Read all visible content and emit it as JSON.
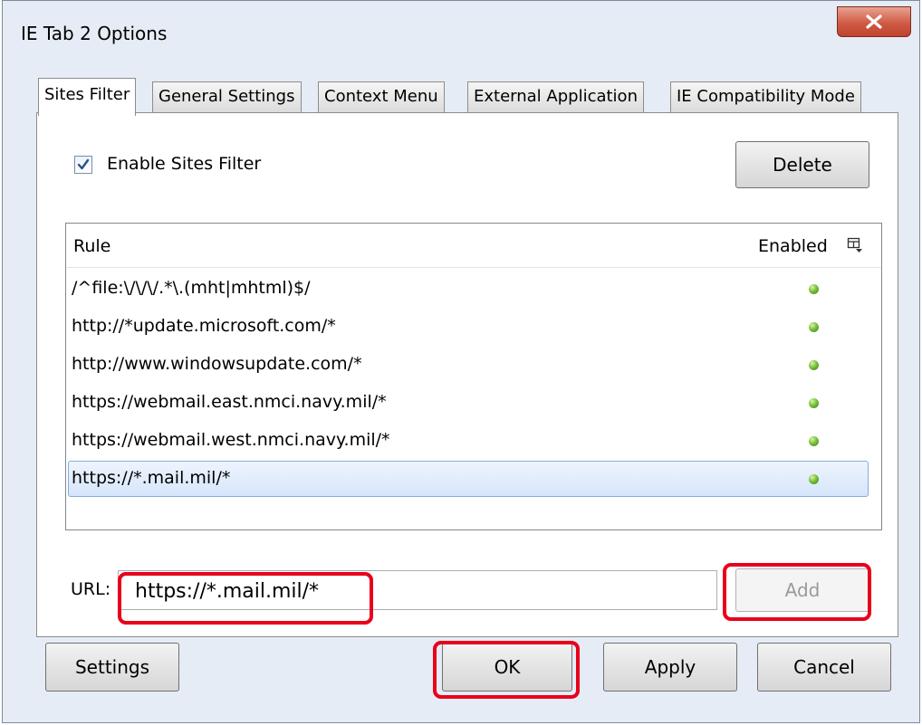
{
  "window": {
    "title": "IE Tab 2 Options"
  },
  "tabs": [
    {
      "label": "Sites Filter",
      "active": true
    },
    {
      "label": "General Settings"
    },
    {
      "label": "Context Menu"
    },
    {
      "label": "External Application"
    },
    {
      "label": "IE Compatibility Mode"
    }
  ],
  "sites_filter": {
    "enable_label": "Enable Sites Filter",
    "enable_checked": true,
    "delete_label": "Delete",
    "columns": {
      "rule": "Rule",
      "enabled": "Enabled"
    },
    "rules": [
      {
        "rule": "/^file:\\/\\/\\/.*\\.(mht|mhtml)$/",
        "enabled": true
      },
      {
        "rule": "http://*update.microsoft.com/*",
        "enabled": true
      },
      {
        "rule": "http://www.windowsupdate.com/*",
        "enabled": true
      },
      {
        "rule": "https://webmail.east.nmci.navy.mil/*",
        "enabled": true
      },
      {
        "rule": "https://webmail.west.nmci.navy.mil/*",
        "enabled": true
      },
      {
        "rule": "https://*.mail.mil/*",
        "enabled": true,
        "selected": true
      }
    ],
    "url_label": "URL:",
    "url_value": "https://*.mail.mil/*",
    "add_label": "Add"
  },
  "footer": {
    "settings_label": "Settings",
    "ok_label": "OK",
    "apply_label": "Apply",
    "cancel_label": "Cancel"
  },
  "colors": {
    "highlight": "#e8001c",
    "selection": "#d6e6fb",
    "enabled_dot": "#78c13c"
  }
}
